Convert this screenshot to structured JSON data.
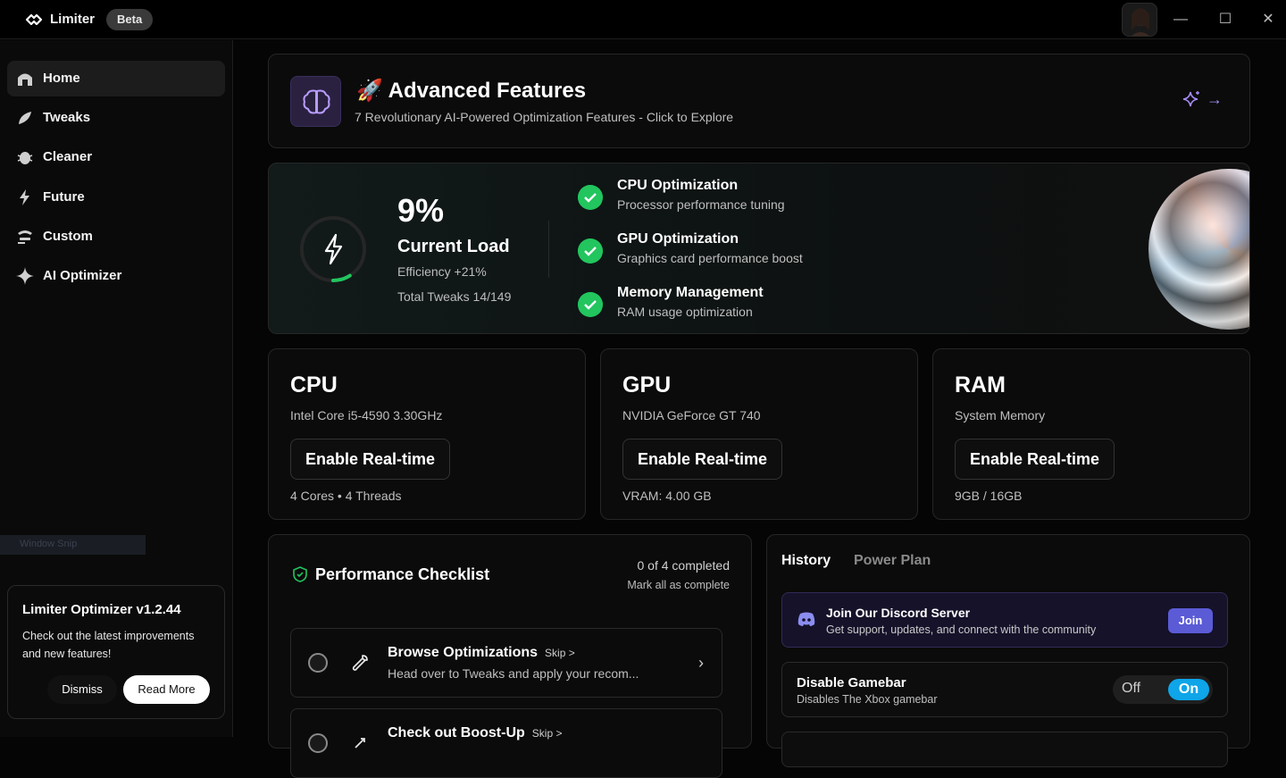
{
  "app": {
    "name": "Limiter",
    "badge": "Beta"
  },
  "window_controls": {
    "minimize": "—",
    "maximize": "☐",
    "close": "✕"
  },
  "sidebar": {
    "items": [
      {
        "label": "Home",
        "icon": "home-icon",
        "active": true
      },
      {
        "label": "Tweaks",
        "icon": "feather-icon"
      },
      {
        "label": "Cleaner",
        "icon": "bug-icon"
      },
      {
        "label": "Future",
        "icon": "bolt-icon"
      },
      {
        "label": "Custom",
        "icon": "sliders-icon"
      },
      {
        "label": "AI Optimizer",
        "icon": "sparkle-icon"
      }
    ],
    "snip_text": "Window Snip",
    "promo": {
      "title": "Limiter Optimizer v1.2.44",
      "text": "Check out the latest improvements and new features!",
      "dismiss": "Dismiss",
      "read_more": "Read More"
    }
  },
  "advanced": {
    "emoji": "🚀",
    "title": "Advanced Features",
    "subtitle": "7 Revolutionary AI-Powered Optimization Features - Click to Explore",
    "arrow": "→"
  },
  "load": {
    "percent": "9%",
    "percent_value": 9,
    "label": "Current Load",
    "efficiency": "Efficiency +21%",
    "total_tweaks": "Total Tweaks 14/149",
    "optimizations": [
      {
        "title": "CPU Optimization",
        "desc": "Processor performance tuning"
      },
      {
        "title": "GPU Optimization",
        "desc": "Graphics card performance boost"
      },
      {
        "title": "Memory Management",
        "desc": "RAM usage optimization"
      }
    ]
  },
  "hardware": [
    {
      "title": "CPU",
      "sub": "Intel Core i5-4590 3.30GHz",
      "button": "Enable Real-time",
      "foot": "4 Cores • 4 Threads"
    },
    {
      "title": "GPU",
      "sub": "NVIDIA GeForce GT 740",
      "button": "Enable Real-time",
      "foot": "VRAM: 4.00 GB"
    },
    {
      "title": "RAM",
      "sub": "System Memory",
      "button": "Enable Real-time",
      "foot": "9GB / 16GB"
    }
  ],
  "checklist": {
    "title": "Performance Checklist",
    "count": "0 of 4 completed",
    "mark_all": "Mark all as complete",
    "items": [
      {
        "title": "Browse Optimizations",
        "skip": "Skip >",
        "desc": "Head over to Tweaks and apply your recom..."
      },
      {
        "title": "Check out Boost-Up",
        "skip": "Skip >",
        "desc": ""
      }
    ]
  },
  "history": {
    "tabs": [
      "History",
      "Power Plan"
    ],
    "discord": {
      "title": "Join Our Discord Server",
      "desc": "Get support, updates, and connect with the community",
      "button": "Join"
    },
    "gamebar": {
      "title": "Disable Gamebar",
      "desc": "Disables The Xbox gamebar",
      "off": "Off",
      "on": "On"
    }
  },
  "colors": {
    "accent_green": "#22c55e",
    "accent_purple": "#a78bfa",
    "toggle_on": "#0ea5e9",
    "discord": "#5b5bd6"
  }
}
